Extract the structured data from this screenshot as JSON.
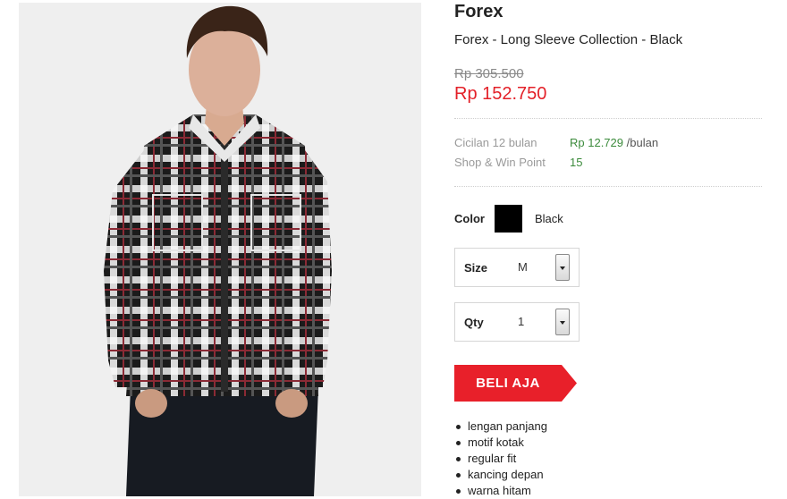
{
  "product_image": {
    "alt_icon": "product-photo"
  },
  "product": {
    "brand": "Forex",
    "name": "Forex - Long Sleeve Collection - Black",
    "old_price": "Rp 305.500",
    "new_price": "Rp 152.750"
  },
  "installment": {
    "label": "Cicilan 12 bulan",
    "value": "Rp 12.729",
    "unit": "/bulan"
  },
  "points": {
    "label": "Shop & Win Point",
    "value": "15"
  },
  "color": {
    "label": "Color",
    "value": "Black",
    "swatch": "#000000"
  },
  "size": {
    "label": "Size",
    "value": "M"
  },
  "qty": {
    "label": "Qty",
    "value": "1"
  },
  "buy_button": {
    "label": "BELI AJA",
    "color": "#e8202a"
  },
  "features": [
    "lengan panjang",
    "motif kotak",
    "regular fit",
    "kancing depan",
    "warna hitam"
  ],
  "colors": {
    "price": "#e32028",
    "green": "#3c8b3c",
    "muted": "#9a9a9a"
  }
}
